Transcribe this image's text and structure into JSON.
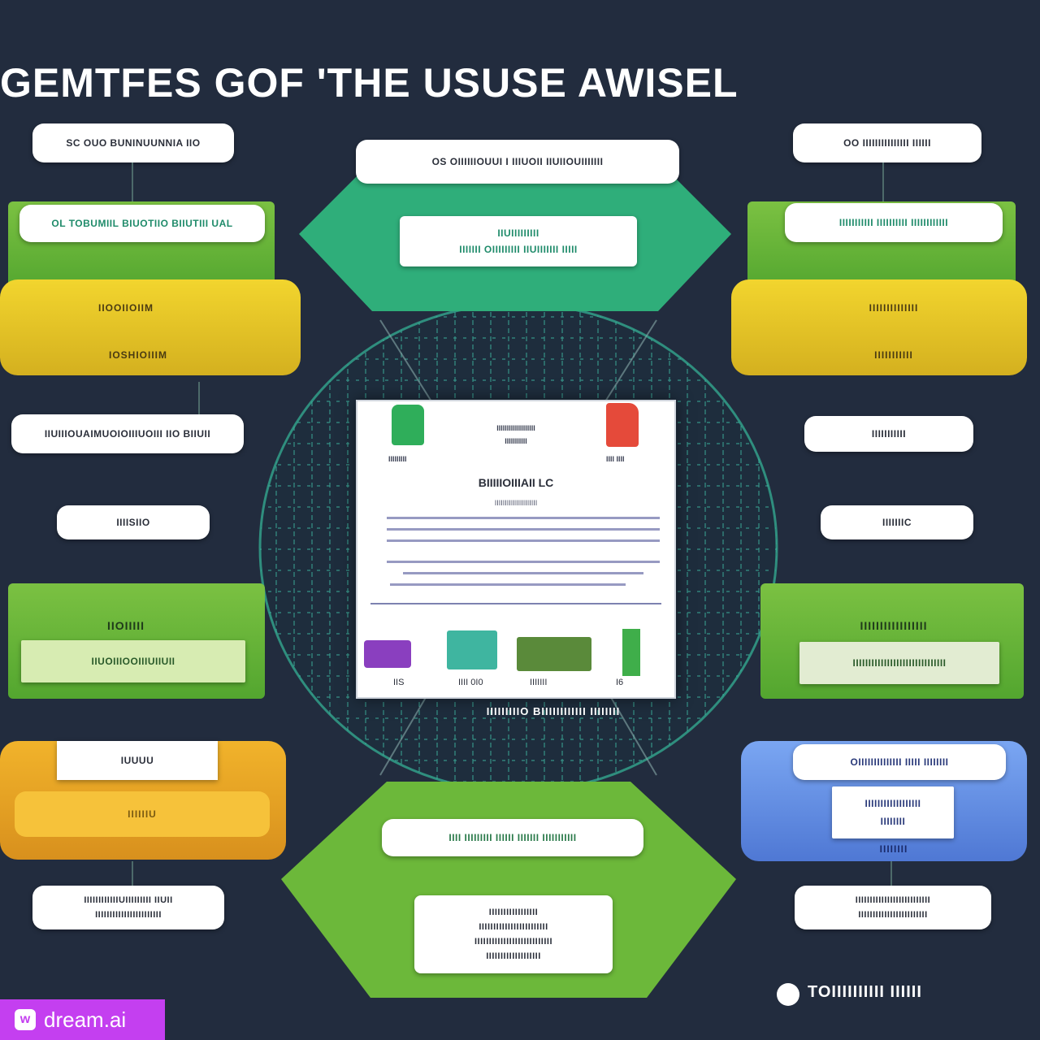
{
  "title": "GEMTFES GOF 'THE USUSE AWISEL",
  "colors": {
    "background": "#222c3e",
    "green": "#6cb83a",
    "yellow": "#e6c628",
    "orange": "#e6a424",
    "blue": "#6a94e8",
    "teal": "#2fae7a"
  },
  "left": {
    "top_label": "SC OUO BUNINUUNNIA IIO",
    "green_pill": "OL TOBUMIIL BIUOTIIO BIIUTIII UAL",
    "yellow_label_1": "IIOOIIOIIM",
    "yellow_label_2": "IOSHIOIIIM",
    "mid_label": "IIUIIIOUAIMUOIOIIIUOIII IIO BIIUII",
    "small_label": "IIIISIIO",
    "green_block_title": "IIOIIIII",
    "green_block_text": "IIUOIIIOOIIIUIIUII",
    "orange_pill": "IUUUU",
    "orange_inner": "IIIIIIU",
    "bottom_label_1": "IIIIIIIIIIIIUIIIIIIIII IIUII",
    "bottom_label_2": "IIIIIIIIIIIIIIIIIIIIIII"
  },
  "center": {
    "top_pill": "OS OIIIIIIOUUI I IIIUOII IIUIIOUIIIIIII",
    "top_inner_1": "IIUIIIIIIIII",
    "top_inner_2": "IIIIIII OIIIIIIIII IIUIIIIIII IIIII",
    "doc_header_1": "IIIIIIIIIIIIIIIIIII",
    "doc_header_2": "IIIIIIIIIII",
    "doc_left_tag": "IIIIIIIII",
    "doc_right_tag": "IIII IIII",
    "doc_title": "BIIIIIOIIIAII LC",
    "doc_sub": "IIIIIIIIIIIIIIIIIIIII",
    "doc_captions": [
      "IIS",
      "IIII 0I0",
      "IIIIIII",
      "I6"
    ],
    "bottom_band": "IIIIIIIIIO BIIIIIIIIIIII IIIIIIII",
    "bottom_pill": "IIII IIIIIIIII IIIIII IIIIIII IIIIIIIIIII",
    "bottom_inner_1": "IIIIIIIIIIIIIIIII",
    "bottom_inner_2": "IIIIIIIIIIIIIIIIIIIIIIII",
    "bottom_inner_3": "IIIIIIIIIIIIIIIIIIIIIIIIIII",
    "bottom_inner_4": "IIIIIIIIIIIIIIIIIII"
  },
  "right": {
    "top_label": "OO IIIIIIIIIIIIIII IIIIII",
    "green_pill": "IIIIIIIIIII IIIIIIIIII IIIIIIIIIIII",
    "yellow_label_1": "IIIIIIIIIIIIII",
    "yellow_label_2": "IIIIIIIIIII",
    "mid_label": "IIIIIIIIIII",
    "small_label": "IIIIIIIC",
    "green_block_title": "IIIIIIIIIIIIIIIII",
    "green_block_text": "IIIIIIIIIIIIIIIIIIIIIIIIIIIIII",
    "blue_pill": "OIIIIIIIIIIIIII IIIII IIIIIIII",
    "blue_inner_1": "IIIIIIIIIIIIIIIIII",
    "blue_inner_2": "IIIIIIII",
    "blue_footer": "IIIIIIII",
    "bottom_label_1": "IIIIIIIIIIIIIIIIIIIIIIIIII",
    "bottom_label_2": "IIIIIIIIIIIIIIIIIIIIIIII"
  },
  "credit": "TOIIIIIIIIII IIIIII",
  "watermark": "dream.ai",
  "icons": [
    "globe-grid",
    "green-tab-icon",
    "red-flag-icon",
    "chart-illustration",
    "bookmark-icon"
  ]
}
